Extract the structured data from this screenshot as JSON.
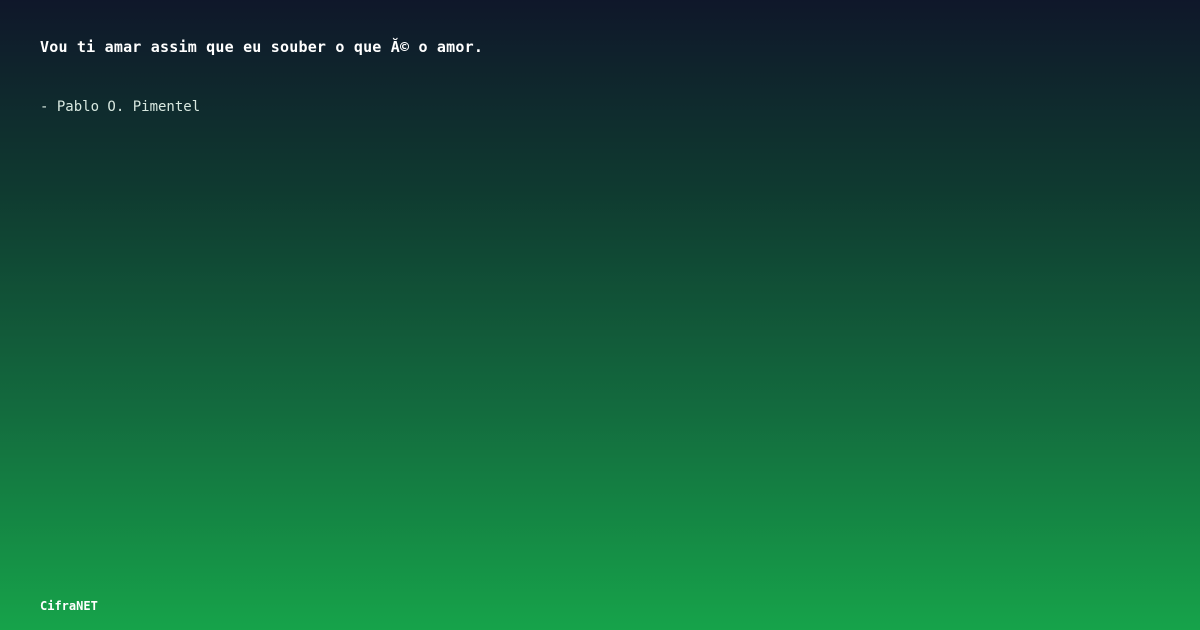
{
  "quote": {
    "text": "Vou ti amar assim que eu souber o que Ă© o amor.",
    "author": "- Pablo O. Pimentel"
  },
  "brand": {
    "name": "CifraNET"
  }
}
